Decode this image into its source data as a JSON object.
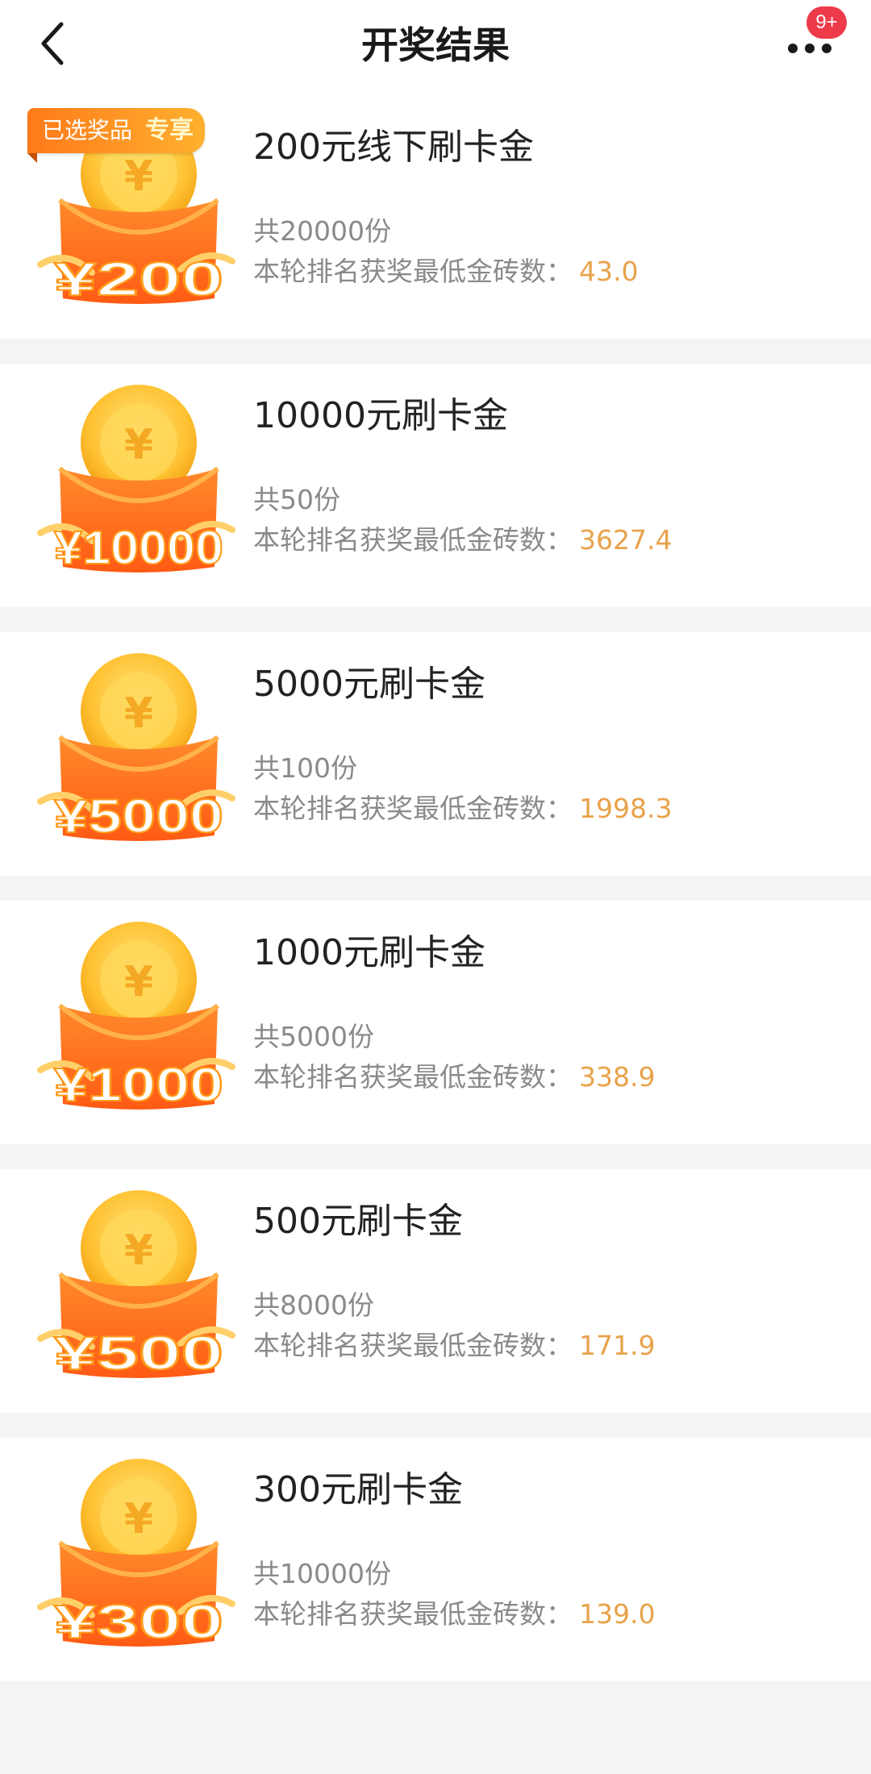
{
  "header": {
    "title": "开奖结果",
    "badge": "9+"
  },
  "icons": {
    "back": "chevron-left-icon",
    "more": "more-horizontal-icon",
    "prize": "coin-red-envelope-icon"
  },
  "colors": {
    "value": "#e8a24a",
    "badge": "#ee3b4a",
    "tag_start": "#ff7a1a",
    "tag_end": "#ffb02e"
  },
  "selected_tag": {
    "label": "已选奖品",
    "accent": "专享"
  },
  "prizes": [
    {
      "name": "200元线下刷卡金",
      "amount": "¥200",
      "count": "共20000份",
      "rank_label": "本轮排名获奖最低金砖数：",
      "rank_value": "43.0"
    },
    {
      "name": "10000元刷卡金",
      "amount": "¥10000",
      "count": "共50份",
      "rank_label": "本轮排名获奖最低金砖数：",
      "rank_value": "3627.4"
    },
    {
      "name": "5000元刷卡金",
      "amount": "¥5000",
      "count": "共100份",
      "rank_label": "本轮排名获奖最低金砖数：",
      "rank_value": "1998.3"
    },
    {
      "name": "1000元刷卡金",
      "amount": "¥1000",
      "count": "共5000份",
      "rank_label": "本轮排名获奖最低金砖数：",
      "rank_value": "338.9"
    },
    {
      "name": "500元刷卡金",
      "amount": "¥500",
      "count": "共8000份",
      "rank_label": "本轮排名获奖最低金砖数：",
      "rank_value": "171.9"
    },
    {
      "name": "300元刷卡金",
      "amount": "¥300",
      "count": "共10000份",
      "rank_label": "本轮排名获奖最低金砖数：",
      "rank_value": "139.0"
    }
  ]
}
